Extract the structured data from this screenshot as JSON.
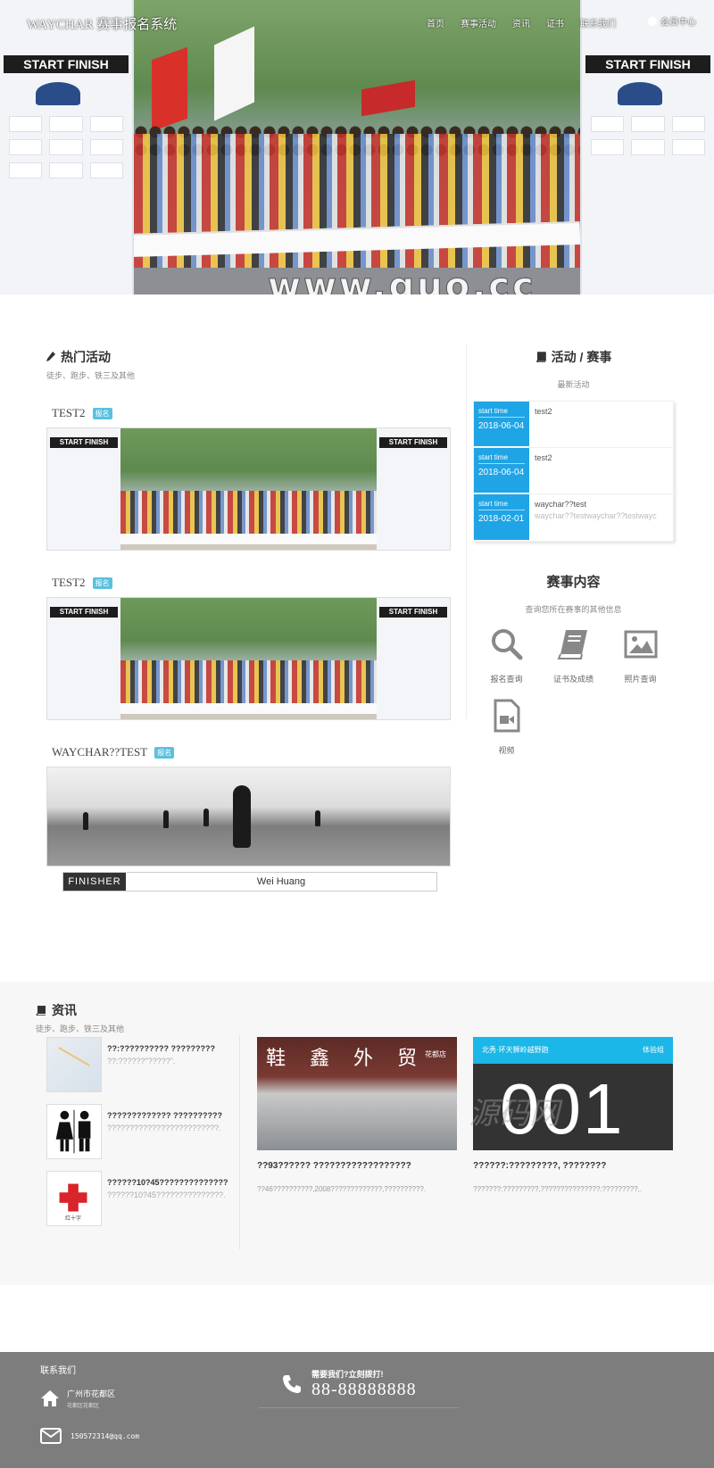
{
  "nav": {
    "brand": "WAYCHAR 赛事报名系统",
    "menu": [
      "首页",
      "赛事活动",
      "资讯",
      "证书",
      "联系我们"
    ],
    "user": "会员中心"
  },
  "hero": {
    "banner_text": "START FINISH",
    "watermark": "www.guo.cc"
  },
  "hot": {
    "title": "热门活动",
    "subtitle": "徒步、跑步、铁三及其他",
    "items": [
      {
        "title": "TEST2",
        "badge": "报名"
      },
      {
        "title": "TEST2",
        "badge": "报名"
      },
      {
        "title": "WAYCHAR??TEST",
        "badge": "报名"
      }
    ],
    "finisher_label": "FINISHER",
    "finisher_name": "Wei Huang"
  },
  "events": {
    "title": "活动 / 赛事",
    "subtitle": "最新活动",
    "list": [
      {
        "date_label": "start time",
        "date": "2018-06-04",
        "title": "test2",
        "summary": ""
      },
      {
        "date_label": "start time",
        "date": "2018-06-04",
        "title": "test2",
        "summary": ""
      },
      {
        "date_label": "start time",
        "date": "2018-02-01",
        "title": "waychar??test",
        "summary": "waychar??testwaychar??testwayc"
      }
    ]
  },
  "content": {
    "title": "赛事内容",
    "subtitle": "查询您所在赛事的其他信息",
    "tools": [
      {
        "label": "报名查询",
        "icon": "search-icon"
      },
      {
        "label": "证书及成绩",
        "icon": "book-icon"
      },
      {
        "label": "照片查询",
        "icon": "picture-icon"
      },
      {
        "label": "视频",
        "icon": "video-file-icon"
      }
    ]
  },
  "info": {
    "title": "资讯",
    "subtitle": "徒步、跑步、铁三及其他",
    "items": [
      {
        "title": "??:?????????? ?????????",
        "summary": "??:??????\"?????\"."
      },
      {
        "title": "????????????? ??????????",
        "summary": "?????????????????????????."
      },
      {
        "title": "??????10?45??????????????",
        "summary": "??????10?45???????????????."
      }
    ],
    "thumb_caption": "红十字",
    "features": [
      {
        "title": "??93??????  ??????????????????",
        "desc": "??46??????????,2008?????????????,??????????."
      },
      {
        "title": "??????:?????????, ????????",
        "desc": "???????:?????????,???????????????:?????????,."
      }
    ],
    "shop_sign": "鞋 鑫 外 贸",
    "shop_sub": "花都店",
    "race_banner": "北秀·环天狮岭越野跑",
    "race_label": "体验组",
    "race_number": "001",
    "watermark": "源码网"
  },
  "footer": {
    "contact_title": "联系我们",
    "address": "广州市花都区",
    "address_sub": "花都区花都区",
    "email": "150572314@qq.com",
    "phone_label": "需要我们?立刻拨打!",
    "phone": "88-88888888"
  }
}
